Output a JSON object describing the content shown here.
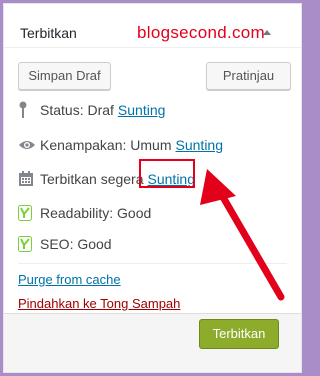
{
  "header": {
    "title": "Terbitkan",
    "watermark": "blogsecond.com"
  },
  "actions": {
    "save_draft": "Simpan Draf",
    "preview": "Pratinjau",
    "publish": "Terbitkan"
  },
  "status": {
    "label": "Status: Draf",
    "edit": "Sunting"
  },
  "visibility": {
    "label": "Kenampakan: Umum",
    "edit": "Sunting"
  },
  "publish_time": {
    "label": "Terbitkan segera",
    "edit": "Sunting"
  },
  "yoast": {
    "readability": "Readability: Good",
    "seo": "SEO: Good"
  },
  "links": {
    "purge": "Purge from cache",
    "trash": "Pindahkan ke Tong Sampah"
  },
  "colors": {
    "frame": "#a88dc8",
    "annotation": "#e3001b",
    "link": "#0073aa",
    "trash": "#a00000",
    "publish_button": "#8dac2c",
    "yoast_good": "#7ad03a"
  }
}
